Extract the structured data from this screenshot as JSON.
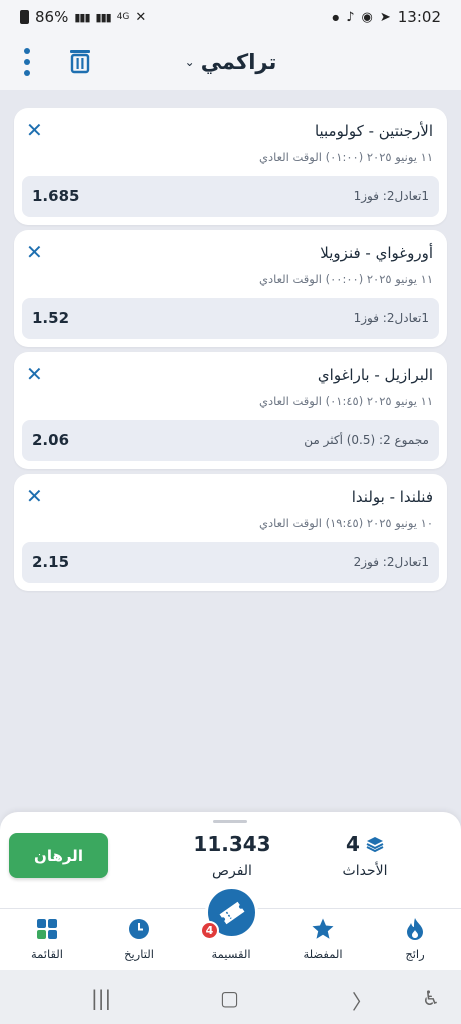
{
  "status_bar": {
    "battery": "86%",
    "network": "4G",
    "time": "13:02"
  },
  "header": {
    "title": "تراكمي",
    "menu_icon": "more-vertical-icon",
    "delete_icon": "trash-icon"
  },
  "bets": [
    {
      "match": "الأرجنتين - كولومبيا",
      "datetime": "١١ يونيو ٢٠٢٥ (٠١:٠٠) الوقت العادي",
      "selection": "1تعادل2: فوز1",
      "odds": "1.685"
    },
    {
      "match": "أوروغواي - فنزويلا",
      "datetime": "١١ يونيو ٢٠٢٥ (٠٠:٠٠) الوقت العادي",
      "selection": "1تعادل2: فوز1",
      "odds": "1.52"
    },
    {
      "match": "البرازيل - باراغواي",
      "datetime": "١١ يونيو ٢٠٢٥ (٠١:٤٥) الوقت العادي",
      "selection": "مجموع 2: (0.5) أكثر من",
      "odds": "2.06"
    },
    {
      "match": "فنلندا - بولندا",
      "datetime": "١٠ يونيو ٢٠٢٥ (١٩:٤٥) الوقت العادي",
      "selection": "1تعادل2: فوز2",
      "odds": "2.15"
    }
  ],
  "summary": {
    "bet_button": "الرهان",
    "total_odds": "11.343",
    "total_odds_label": "الفرص",
    "events_count": "4",
    "events_label": "الأحداث"
  },
  "nav": {
    "items": [
      {
        "label": "رائج",
        "icon": "flame-icon"
      },
      {
        "label": "المفضلة",
        "icon": "star-icon"
      },
      {
        "label": "القسيمة",
        "icon": "ticket-icon",
        "badge": "4"
      },
      {
        "label": "التاريخ",
        "icon": "clock-icon"
      },
      {
        "label": "القائمة",
        "icon": "grid-icon"
      }
    ]
  },
  "colors": {
    "accent": "#1e6fb0",
    "bet_button": "#3ba85f",
    "badge": "#e03b3b",
    "background": "#e6e8ef"
  }
}
